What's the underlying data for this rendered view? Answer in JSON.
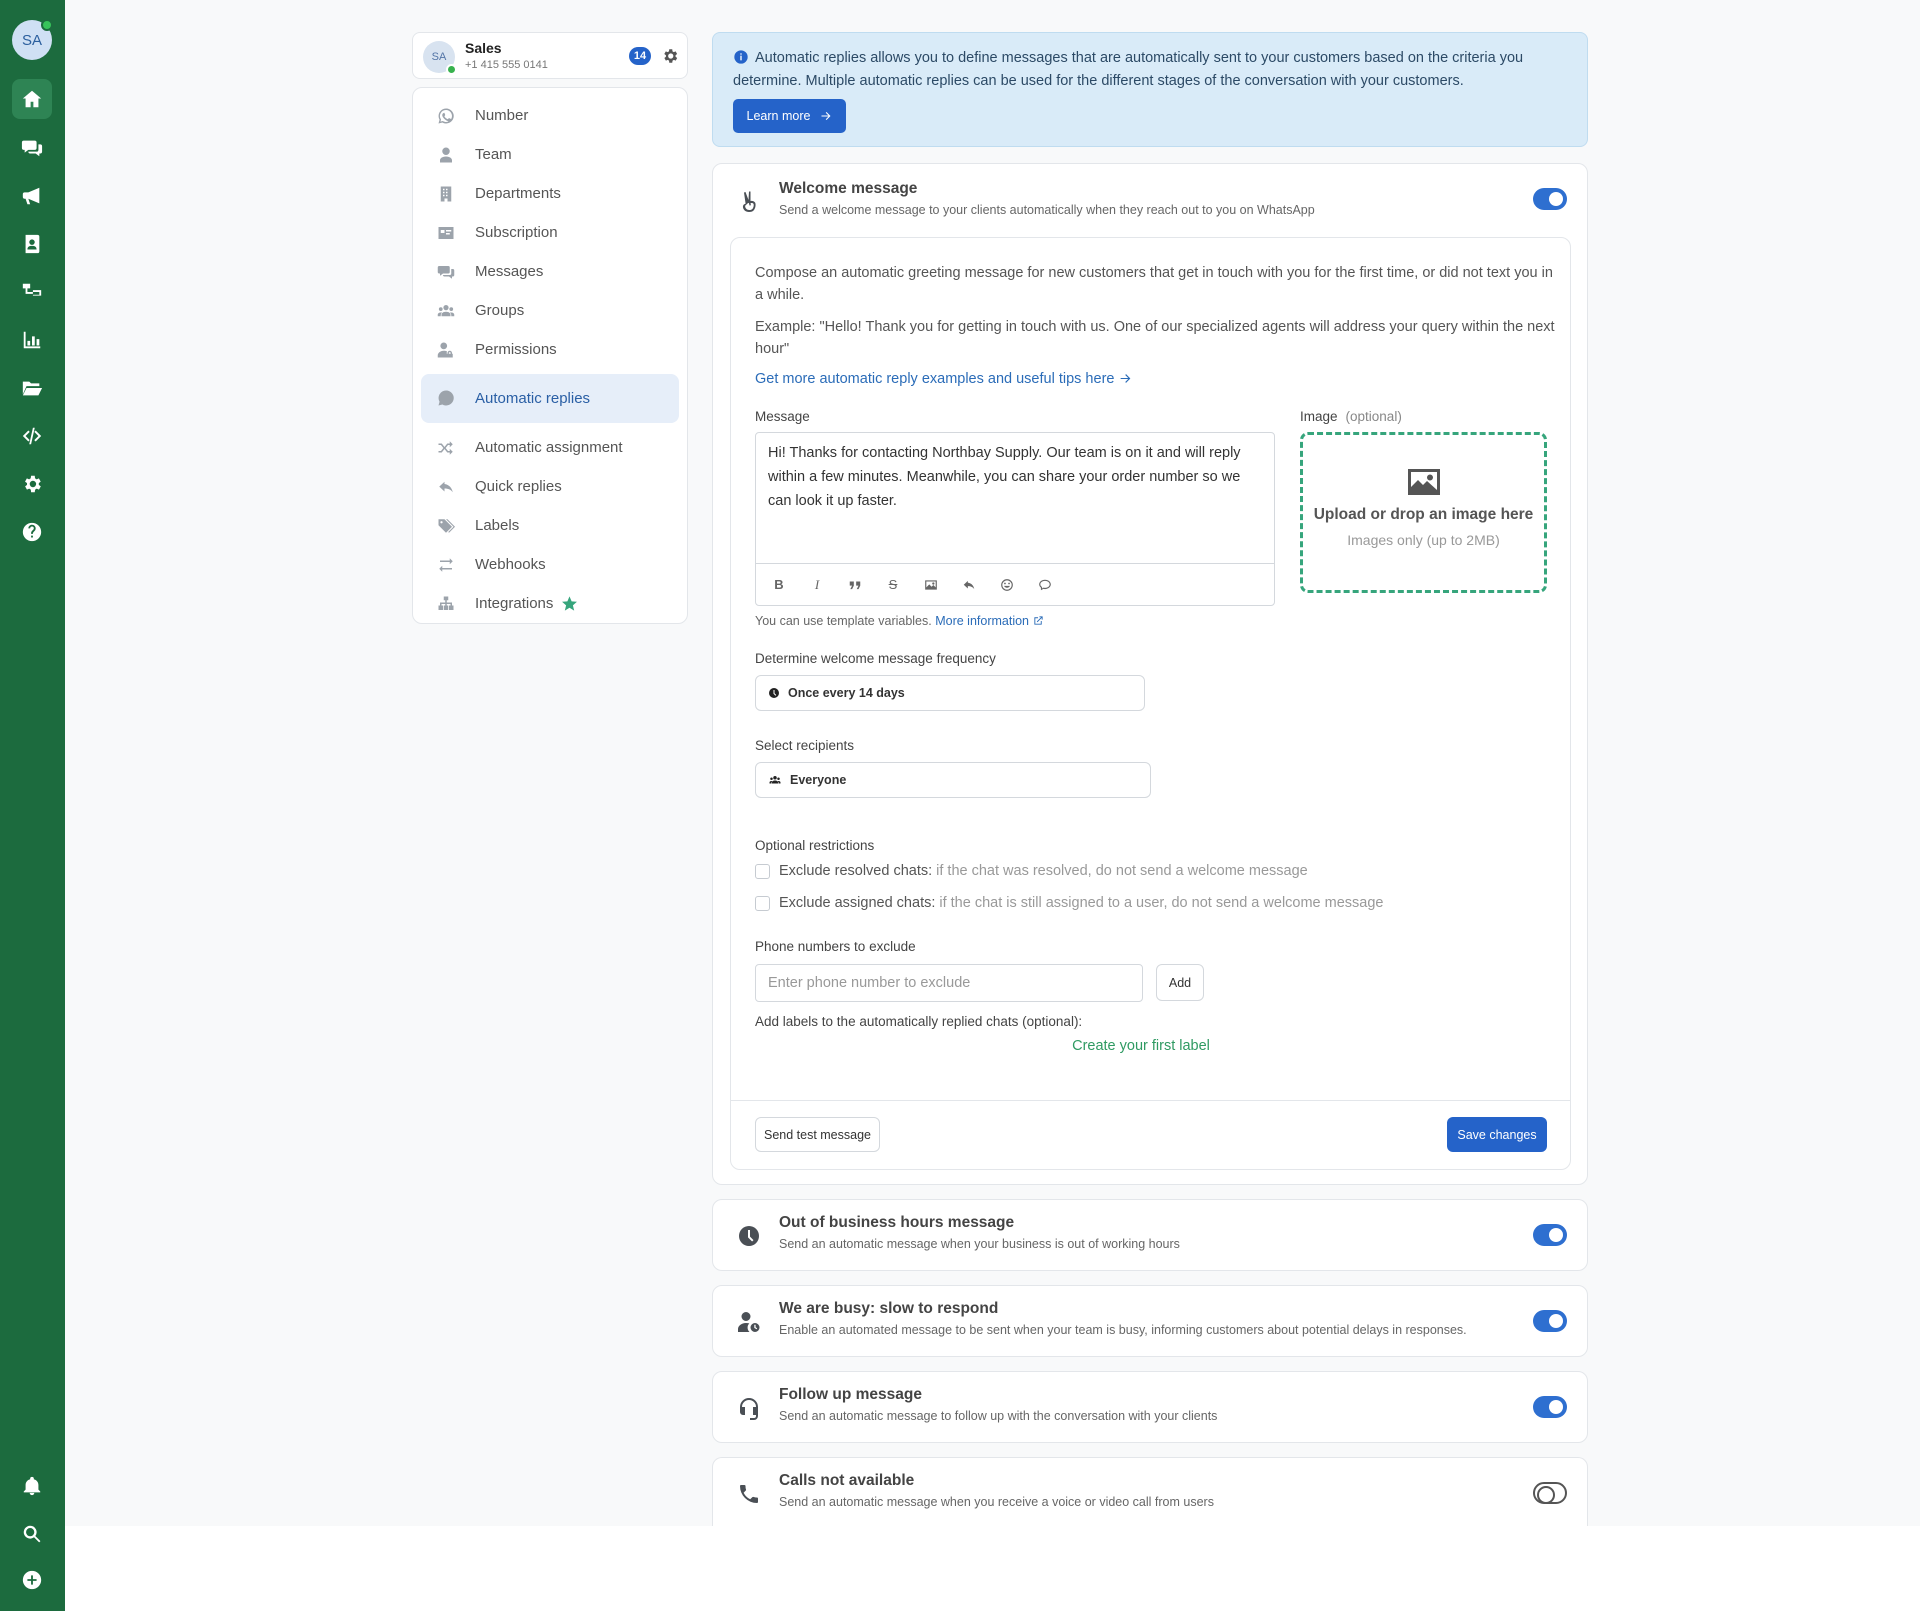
{
  "rail": {
    "avatar_initials": "SA",
    "icons": [
      "home-icon",
      "chats-icon",
      "megaphone-icon",
      "contacts-icon",
      "flows-icon",
      "analytics-icon",
      "folder-icon",
      "code-icon",
      "settings-icon",
      "help-icon"
    ],
    "bottom_icons": [
      "bell-icon",
      "search-icon",
      "plus-circle-icon"
    ]
  },
  "account": {
    "initials": "SA",
    "name": "Sales",
    "phone": "+1 415 555 0141",
    "badge": "14"
  },
  "nav": {
    "items": [
      {
        "label": "Number",
        "icon": "whatsapp-icon"
      },
      {
        "label": "Team",
        "icon": "user-icon"
      },
      {
        "label": "Departments",
        "icon": "building-icon"
      },
      {
        "label": "Subscription",
        "icon": "id-card-icon"
      },
      {
        "label": "Messages",
        "icon": "messages-icon"
      },
      {
        "label": "Groups",
        "icon": "users-icon"
      },
      {
        "label": "Permissions",
        "icon": "user-lock-icon"
      },
      {
        "label": "Automatic replies",
        "icon": "auto-reply-icon",
        "active": true
      },
      {
        "label": "Automatic assignment",
        "icon": "shuffle-icon"
      },
      {
        "label": "Quick replies",
        "icon": "reply-icon"
      },
      {
        "label": "Labels",
        "icon": "tags-icon"
      },
      {
        "label": "Webhooks",
        "icon": "exchange-icon"
      },
      {
        "label": "Integrations",
        "icon": "sitemap-icon"
      }
    ]
  },
  "info": {
    "text": "Automatic replies allows you to define messages that are automatically sent to your customers based on the criteria you determine. Multiple automatic replies can be used for the different stages of the conversation with your customers.",
    "learn_more": "Learn more"
  },
  "welcome": {
    "title": "Welcome message",
    "description": "Send a welcome message to your clients automatically when they reach out to you on WhatsApp",
    "enabled": true,
    "intro": "Compose an automatic greeting message for new customers that get in touch with you for the first time, or did not text you in a while.",
    "example": "Example: \"Hello! Thank you for getting in touch with us. One of our specialized agents will address your query within the next hour\"",
    "tips_link": "Get more automatic reply examples and useful tips here",
    "message_label": "Message",
    "message_value": "Hi! Thanks for contacting Northbay Supply. Our team is on it and will reply within a few minutes. Meanwhile, you can share your order number so we can look it up faster.",
    "image_label": "Image",
    "image_optional": "(optional)",
    "upload_title": "Upload or drop an image here",
    "upload_hint": "Images only (up to 2MB)",
    "template_note": "You can use template variables.",
    "more_info": "More information",
    "frequency_label": "Determine welcome message frequency",
    "frequency_value": "Once every 14 days",
    "recipients_label": "Select recipients",
    "recipients_value": "Everyone",
    "restrictions_label": "Optional restrictions",
    "restriction1_label": "Exclude resolved chats:",
    "restriction1_hint": "if the chat was resolved, do not send a welcome message",
    "restriction2_label": "Exclude assigned chats:",
    "restriction2_hint": "if the chat is still assigned to a user, do not send a welcome message",
    "phones_label": "Phone numbers to exclude",
    "phone_placeholder": "Enter phone number to exclude",
    "add_button": "Add",
    "labels_label": "Add labels to the automatically replied chats (optional):",
    "create_label": "Create your first label",
    "send_test": "Send test message",
    "save": "Save changes"
  },
  "other_replies": [
    {
      "title": "Out of business hours message",
      "description": "Send an automatic message when your business is out of working hours",
      "icon": "clock-icon",
      "enabled": true
    },
    {
      "title": "We are busy: slow to respond",
      "description": "Enable an automated message to be sent when your team is busy, informing customers about potential delays in responses.",
      "icon": "user-clock-icon",
      "enabled": true
    },
    {
      "title": "Follow up message",
      "description": "Send an automatic message to follow up with the conversation with your clients",
      "icon": "headset-icon",
      "enabled": true
    },
    {
      "title": "Calls not available",
      "description": "Send an automatic message when you receive a voice or video call from users",
      "icon": "phone-icon",
      "enabled": false
    }
  ],
  "colors": {
    "rail": "#1c6b3e",
    "primary": "#2563c9",
    "accent_green": "#36a57c",
    "info_bg": "#d9ebf8"
  }
}
